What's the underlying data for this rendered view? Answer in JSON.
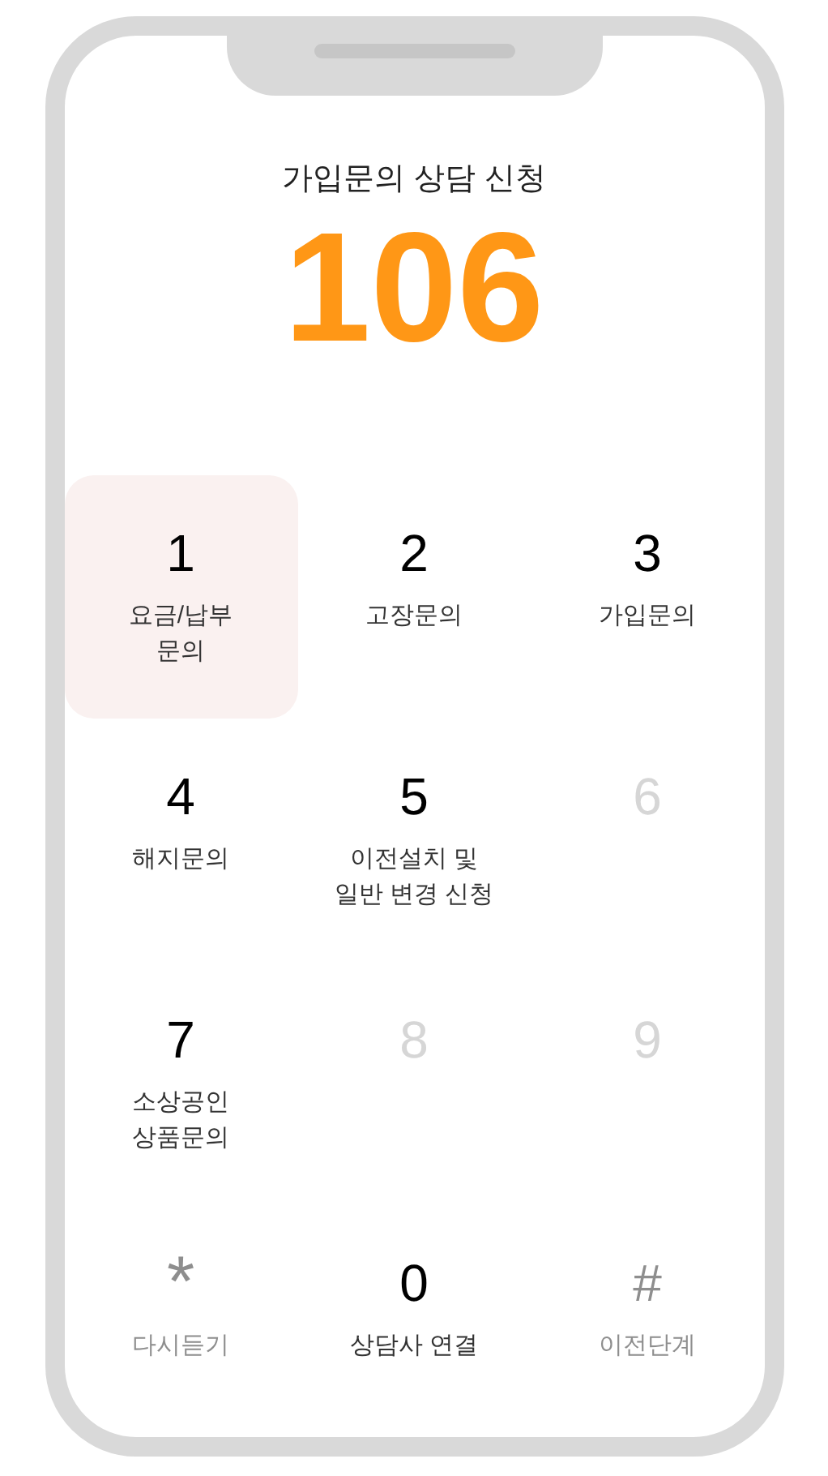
{
  "title": "가입문의 상담 신청",
  "number": "106",
  "keys": [
    {
      "digit": "1",
      "label": "요금/납부\n문의",
      "kind": "option",
      "selected": true
    },
    {
      "digit": "2",
      "label": "고장문의",
      "kind": "option",
      "selected": false
    },
    {
      "digit": "3",
      "label": "가입문의",
      "kind": "option",
      "selected": false
    },
    {
      "digit": "4",
      "label": "해지문의",
      "kind": "option",
      "selected": false
    },
    {
      "digit": "5",
      "label": "이전설치 및\n일반 변경 신청",
      "kind": "option",
      "selected": false
    },
    {
      "digit": "6",
      "kind": "unavailable",
      "selected": false
    },
    {
      "digit": "7",
      "label": "소상공인\n상품문의",
      "kind": "option",
      "selected": false
    },
    {
      "digit": "8",
      "kind": "unavailable",
      "selected": false
    },
    {
      "digit": "9",
      "kind": "unavailable",
      "selected": false
    },
    {
      "digit": "*",
      "label": "다시듣기",
      "kind": "control",
      "selected": false
    },
    {
      "digit": "0",
      "label": "상담사 연결",
      "kind": "option",
      "selected": false
    },
    {
      "digit": "#",
      "label": "이전단계",
      "kind": "control",
      "selected": false
    }
  ]
}
